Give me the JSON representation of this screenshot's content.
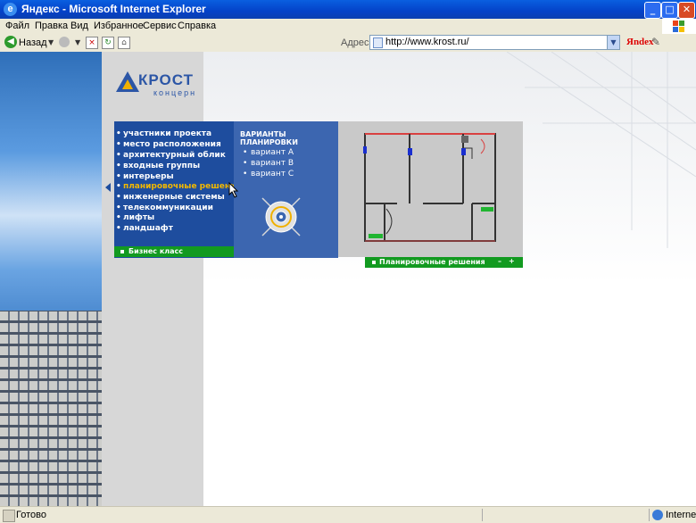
{
  "window": {
    "title": "Яндекс - Microsoft Internet Explorer"
  },
  "menu_bar": [
    "Файл",
    "Правка",
    "Вид",
    "Избранное",
    "Сервис",
    "Справка"
  ],
  "toolbar": {
    "back_label": "Назад",
    "address_label": "Адрес:",
    "address_value": "http://www.krost.ru/",
    "yandex_label": "Яndex"
  },
  "site": {
    "logo_name": "КРОСТ",
    "logo_sub": "концерн",
    "menu_items": [
      "участники проекта",
      "место расположения",
      "архитектурный облик",
      "входные группы",
      "интерьеры",
      "планировочные решения",
      "инженерные системы",
      "телекоммуникации",
      "лифты",
      "ландшафт"
    ],
    "active_index": 5,
    "class_label": "Бизнес класс",
    "variants_heading": "ВАРИАНТЫ ПЛАНИРОВКИ",
    "variants": [
      "вариант А",
      "вариант В",
      "вариант С"
    ],
    "plan_bar_label": "Планировочные решения",
    "zoom_minus": "–",
    "zoom_plus": "+"
  },
  "status": {
    "text": "Готово",
    "zone": "Internet"
  },
  "colors": {
    "menu_blue": "#1e4d9e",
    "variants_blue": "#3c66b0",
    "green": "#129a20",
    "active": "#f2b800"
  }
}
